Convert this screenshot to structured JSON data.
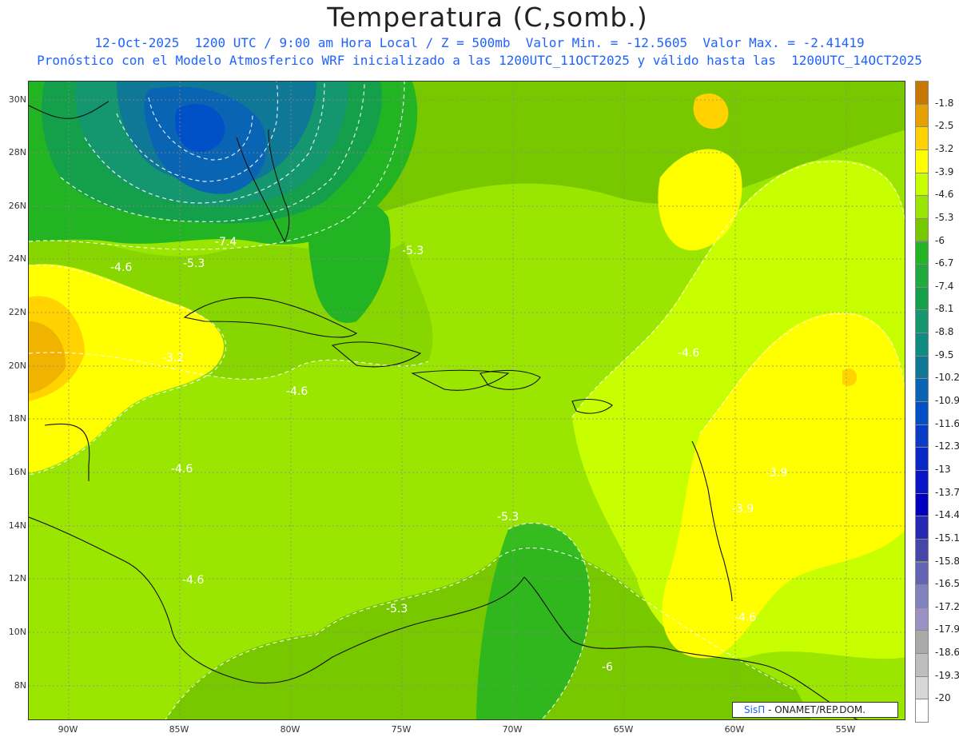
{
  "header": {
    "title": "Temperatura (C,somb.)",
    "line1": "12-Oct-2025  1200 UTC / 9:00 am Hora Local / Z = 500mb  Valor Min. = -12.5605  Valor Max. = -2.41419",
    "line2": "Pronóstico con el Modelo Atmosferico WRF inicializado a las 1200UTC_11OCT2025 y válido hasta las  1200UTC_14OCT2025"
  },
  "axes": {
    "lat": [
      "30N",
      "28N",
      "26N",
      "24N",
      "22N",
      "20N",
      "18N",
      "16N",
      "14N",
      "12N",
      "10N",
      "8N"
    ],
    "lon": [
      "90W",
      "85W",
      "80W",
      "75W",
      "70W",
      "65W",
      "60W",
      "55W"
    ]
  },
  "contour_labels": [
    "-7.4",
    "-4.6",
    "-5.3",
    "-5.3",
    "-3.2",
    "-4.6",
    "-4.6",
    "-4.6",
    "-4.6",
    "-5.3",
    "-5.3",
    "-3.9",
    "-3.9",
    "-4.6",
    "-6"
  ],
  "legend": {
    "labels": [
      "-1.8",
      "-2.5",
      "-3.2",
      "-3.9",
      "-4.6",
      "-5.3",
      "-6",
      "-6.7",
      "-7.4",
      "-8.1",
      "-8.8",
      "-9.5",
      "-10.2",
      "-10.9",
      "-11.6",
      "-12.3",
      "-13",
      "-13.7",
      "-14.4",
      "-15.1",
      "-15.8",
      "-16.5",
      "-17.2",
      "-17.9",
      "-18.6",
      "-19.3",
      "-20"
    ],
    "colors": [
      "#c87800",
      "#e6a000",
      "#ffd200",
      "#ffff00",
      "#c8ff00",
      "#9be600",
      "#78c800",
      "#23b423",
      "#1eaa3c",
      "#14a04b",
      "#14966e",
      "#0f8c82",
      "#0f7896",
      "#0a64b4",
      "#0050c8",
      "#0a3cc8",
      "#0a28c8",
      "#0a14c8",
      "#0000be",
      "#2828b4",
      "#4646aa",
      "#6464b4",
      "#8282be",
      "#9b91c3",
      "#aaaaaa",
      "#bebebe",
      "#d7d7d7",
      "#ffffff"
    ]
  },
  "credit": {
    "brand": "SisΠ",
    "text": "- ONAMET/REP.DOM."
  }
}
